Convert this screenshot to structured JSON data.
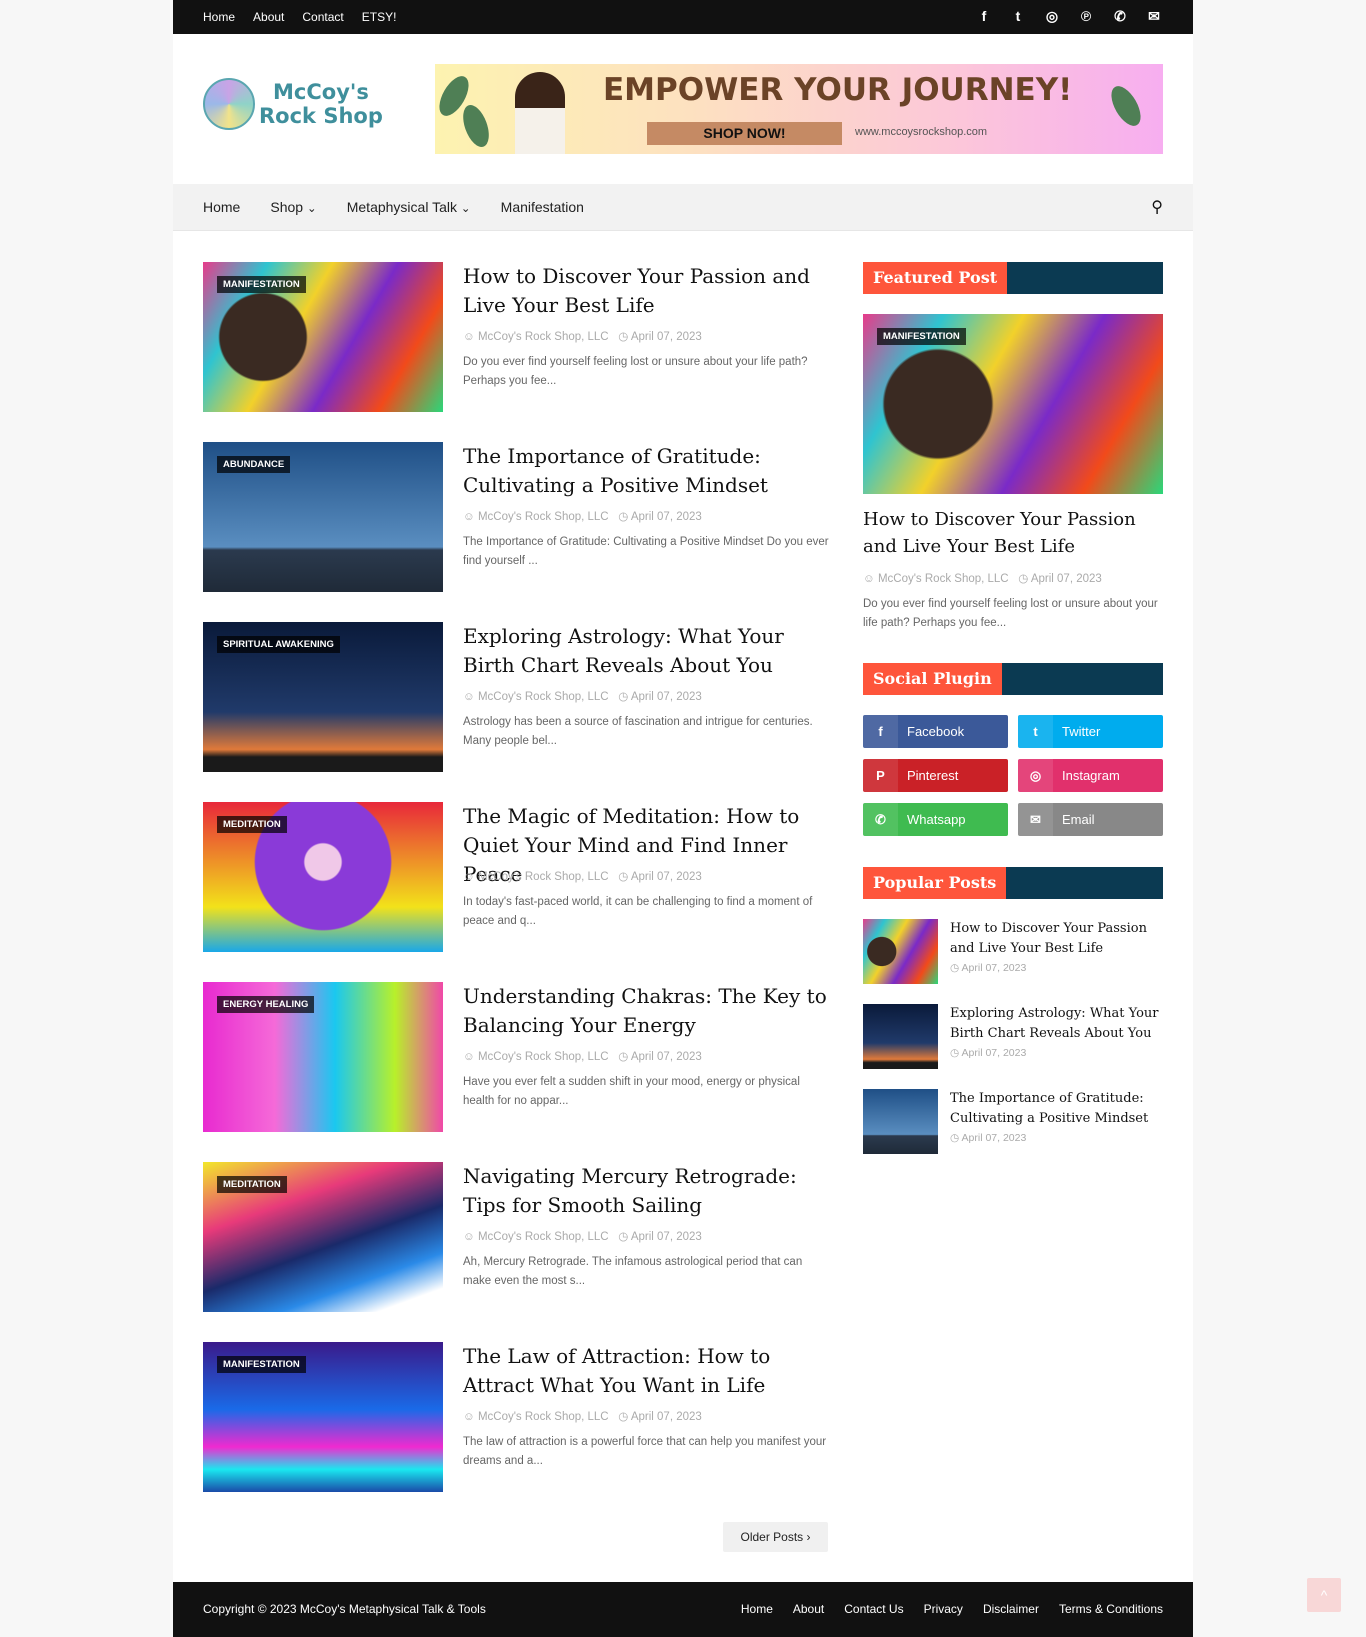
{
  "topbar": {
    "menu": [
      "Home",
      "About",
      "Contact",
      "ETSY!"
    ],
    "social_icons": [
      "facebook-icon",
      "twitter-icon",
      "instagram-icon",
      "pinterest-icon",
      "whatsapp-icon",
      "email-icon"
    ]
  },
  "logo": {
    "line1": "McCoy's",
    "line2": "Rock Shop"
  },
  "banner": {
    "headline": "EMPOWER YOUR JOURNEY!",
    "button": "SHOP NOW!",
    "url": "www.mccoysrockshop.com"
  },
  "nav": {
    "items": [
      "Home",
      "Shop",
      "Metaphysical Talk",
      "Manifestation"
    ],
    "dropdown_chevron": "⌄"
  },
  "posts": [
    {
      "tag": "Manifestation",
      "title": "How to Discover Your Passion and Live Your Best Life",
      "author": "McCoy's Rock Shop, LLC",
      "date": "April 07, 2023",
      "snippet": "Do you ever find yourself feeling lost or unsure about your life path? Perhaps you fee..."
    },
    {
      "tag": "Abundance",
      "title": "The Importance of Gratitude: Cultivating a Positive Mindset",
      "author": "McCoy's Rock Shop, LLC",
      "date": "April 07, 2023",
      "snippet": "The Importance of Gratitude: Cultivating a Positive Mindset Do you ever find yourself ..."
    },
    {
      "tag": "Spiritual Awakening",
      "title": "Exploring Astrology: What Your Birth Chart Reveals About You",
      "author": "McCoy's Rock Shop, LLC",
      "date": "April 07, 2023",
      "snippet": "Astrology has been a source of fascination and intrigue for centuries. Many people bel..."
    },
    {
      "tag": "Meditation",
      "title": "The Magic of Meditation: How to Quiet Your Mind and Find Inner Peace",
      "author": "McCoy's Rock Shop, LLC",
      "date": "April 07, 2023",
      "snippet": "In today's fast-paced world, it can be challenging to find a moment of peace and q..."
    },
    {
      "tag": "Energy Healing",
      "title": "Understanding Chakras: The Key to Balancing Your Energy",
      "author": "McCoy's Rock Shop, LLC",
      "date": "April 07, 2023",
      "snippet": "Have you ever felt a sudden shift in your mood, energy or physical health for no appar..."
    },
    {
      "tag": "Meditation",
      "title": "Navigating Mercury Retrograde: Tips for Smooth Sailing",
      "author": "McCoy's Rock Shop, LLC",
      "date": "April 07, 2023",
      "snippet": "Ah, Mercury Retrograde. The infamous astrological period that can make even the most s..."
    },
    {
      "tag": "Manifestation",
      "title": "The Law of Attraction: How to Attract What You Want in Life",
      "author": "McCoy's Rock Shop, LLC",
      "date": "April 07, 2023",
      "snippet": "The law of attraction is a powerful force that can help you manifest your dreams and a..."
    }
  ],
  "older_posts": "Older Posts ›",
  "sidebar": {
    "featured": {
      "heading": "Featured Post",
      "tag": "Manifestation",
      "title": "How to Discover Your Passion and Live Your Best Life",
      "author": "McCoy's Rock Shop, LLC",
      "date": "April 07, 2023",
      "snippet": "Do you ever find yourself feeling lost or unsure about your life path? Perhaps you fee..."
    },
    "social": {
      "heading": "Social Plugin",
      "buttons": [
        {
          "label": "Facebook",
          "icon": "f",
          "color": "#3b5999"
        },
        {
          "label": "Twitter",
          "icon": "t",
          "color": "#00acee"
        },
        {
          "label": "Pinterest",
          "icon": "P",
          "color": "#ca2127"
        },
        {
          "label": "Instagram",
          "icon": "◎",
          "color": "#e1306c"
        },
        {
          "label": "Whatsapp",
          "icon": "✆",
          "color": "#3fbb50"
        },
        {
          "label": "Email",
          "icon": "✉",
          "color": "#888888"
        }
      ]
    },
    "popular": {
      "heading": "Popular Posts",
      "items": [
        {
          "title": "How to Discover Your Passion and Live Your Best Life",
          "date": "April 07, 2023"
        },
        {
          "title": "Exploring Astrology: What Your Birth Chart Reveals About You",
          "date": "April 07, 2023"
        },
        {
          "title": "The Importance of Gratitude: Cultivating a Positive Mindset",
          "date": "April 07, 2023"
        }
      ]
    }
  },
  "footer": {
    "copyright": "Copyright © 2023 McCoy's Metaphysical Talk & Tools",
    "links": [
      "Home",
      "About",
      "Contact Us",
      "Privacy",
      "Disclaimer",
      "Terms & Conditions"
    ]
  },
  "colors": {
    "accent": "#fe553b",
    "widget_bar": "#0b3a52",
    "topbar": "#111111"
  }
}
